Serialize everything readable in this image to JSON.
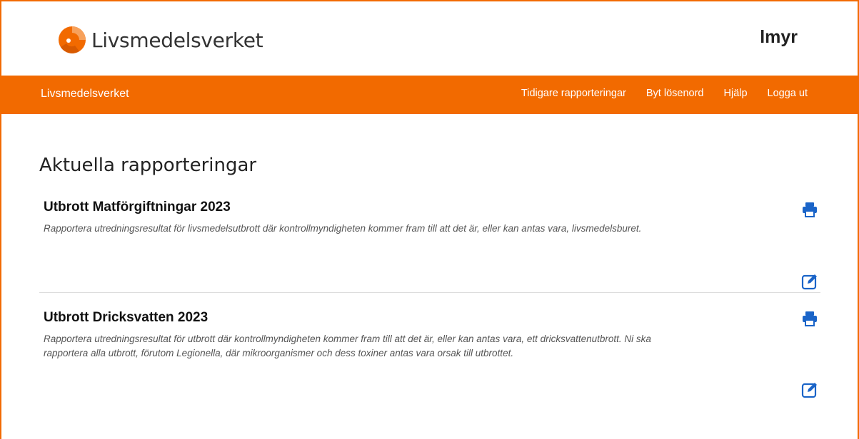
{
  "header": {
    "logo_text": "Livsmedelsverket",
    "user_name": "lmyr"
  },
  "navbar": {
    "brand": "Livsmedelsverket",
    "links": [
      "Tidigare rapporteringar",
      "Byt lösenord",
      "Hjälp",
      "Logga ut"
    ]
  },
  "main": {
    "title": "Aktuella rapporteringar",
    "reports": [
      {
        "title": "Utbrott Matförgiftningar 2023",
        "description": "Rapportera utredningsresultat för livsmedelsutbrott där kontrollmyndigheten kommer fram till att det är, eller kan antas vara, livsmedelsburet.",
        "print_icon": "print-icon",
        "edit_icon": "edit-icon"
      },
      {
        "title": "Utbrott Dricksvatten 2023",
        "description": "Rapportera utredningsresultat för utbrott där kontrollmyndigheten kommer fram till att det är, eller kan antas vara, ett dricksvattenutbrott. Ni ska rapportera alla utbrott, förutom Legionella, där mikroorganismer och dess toxiner antas vara orsak till utbrottet.",
        "print_icon": "print-icon",
        "edit_icon": "edit-icon"
      }
    ]
  },
  "colors": {
    "brand_orange": "#f26a00",
    "icon_blue": "#1a64c8"
  }
}
